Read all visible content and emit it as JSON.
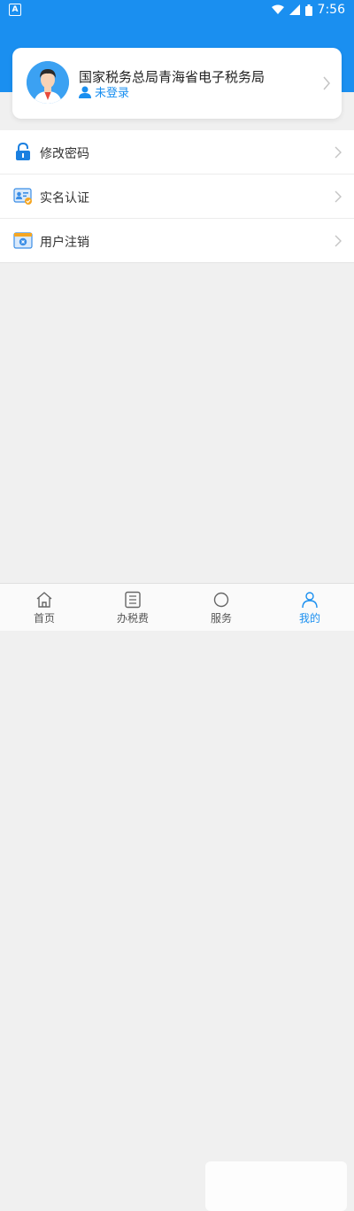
{
  "status_bar": {
    "time": "7:56",
    "notification_icon": "A"
  },
  "profile": {
    "org_name": "国家税务总局青海省电子税务局",
    "login_status": "未登录"
  },
  "menu": {
    "items": [
      {
        "label": "修改密码",
        "icon": "lock-icon"
      },
      {
        "label": "实名认证",
        "icon": "id-card-icon"
      },
      {
        "label": "用户注销",
        "icon": "logout-card-icon"
      }
    ]
  },
  "tabbar": {
    "tabs": [
      {
        "label": "首页",
        "icon": "home-icon"
      },
      {
        "label": "办税费",
        "icon": "list-icon"
      },
      {
        "label": "服务",
        "icon": "service-icon"
      },
      {
        "label": "我的",
        "icon": "profile-icon"
      }
    ]
  },
  "colors": {
    "primary": "#1a8ff0",
    "background": "#f0f0f0",
    "lock": "#1a7fe0",
    "badge": "#f5a623"
  }
}
